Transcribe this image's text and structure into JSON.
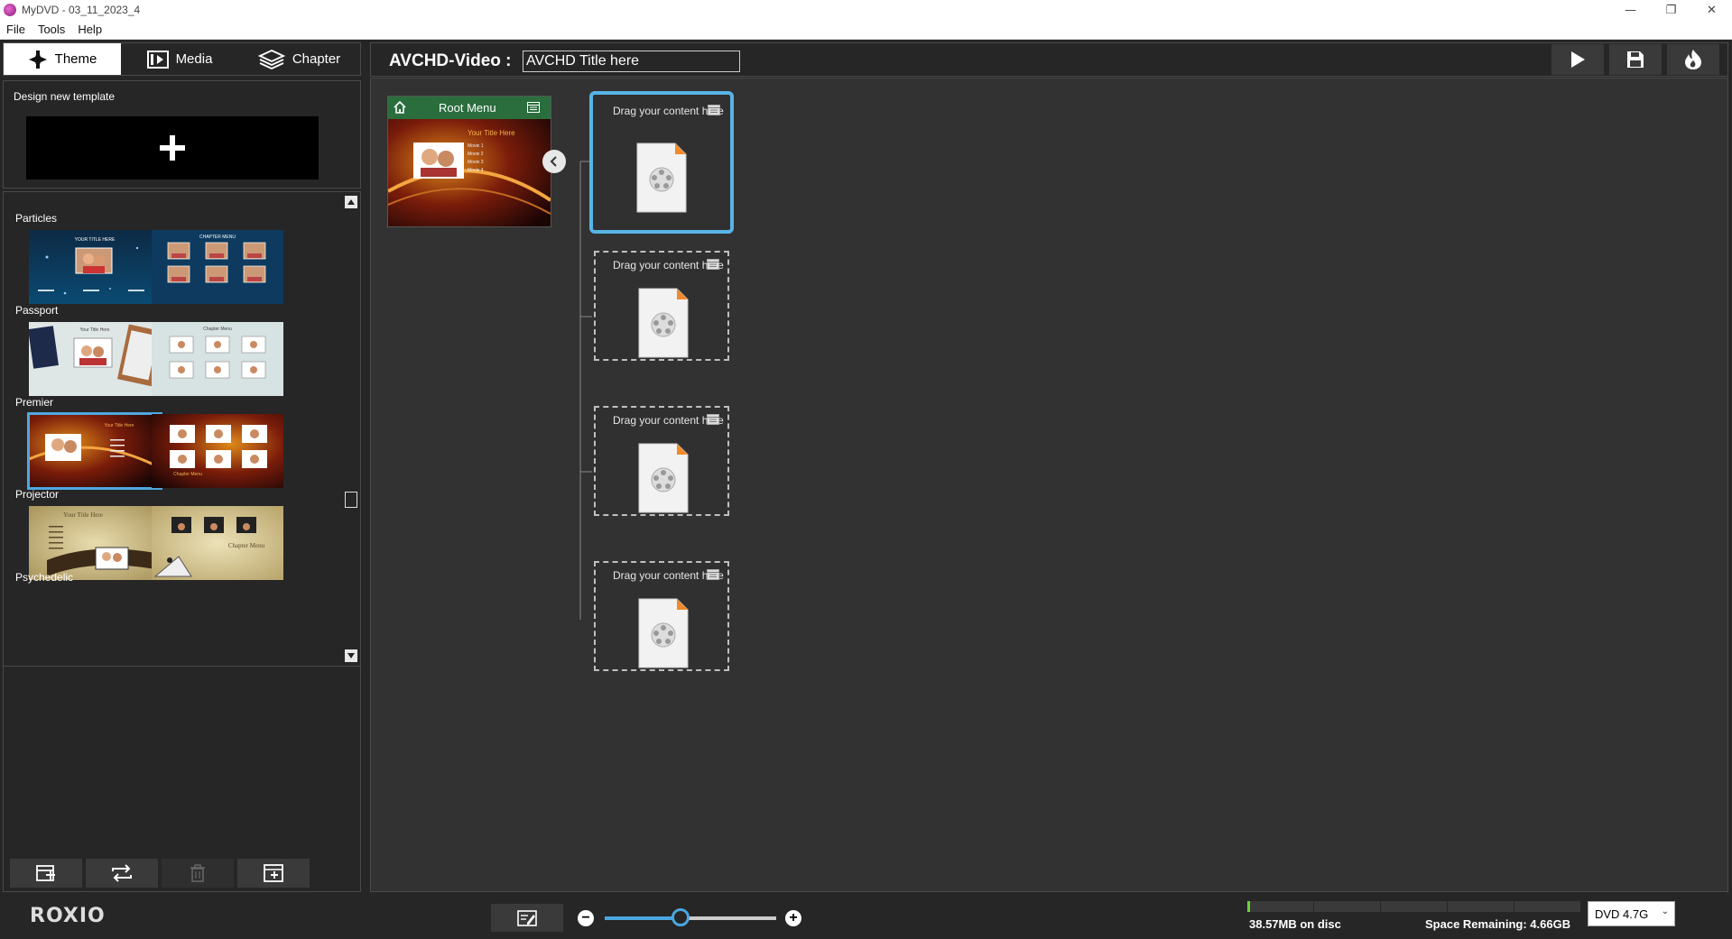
{
  "window": {
    "title": "MyDVD - 03_11_2023_4",
    "controls": {
      "minimize": "—",
      "restore": "❐",
      "close": "✕"
    }
  },
  "menu": {
    "items": [
      "File",
      "Tools",
      "Help"
    ]
  },
  "tabs": [
    {
      "label": "Theme",
      "icon": "theme-icon",
      "active": true
    },
    {
      "label": "Media",
      "icon": "media-icon",
      "active": false
    },
    {
      "label": "Chapter",
      "icon": "chapter-icon",
      "active": false
    }
  ],
  "design": {
    "label": "Design new template",
    "button_icon": "plus-icon"
  },
  "template_categories": [
    {
      "name": "Particles",
      "thumbs": [
        {
          "title": "YOUR TITLE HERE",
          "kind": "main"
        },
        {
          "title": "CHAPTER MENU",
          "kind": "chapter"
        }
      ]
    },
    {
      "name": "Passport",
      "thumbs": [
        {
          "title": "Your Title Here",
          "kind": "main"
        },
        {
          "title": "Chapter Menu",
          "kind": "chapter"
        }
      ]
    },
    {
      "name": "Premier",
      "thumbs": [
        {
          "title": "Your Title Here",
          "kind": "main",
          "selected": true
        },
        {
          "title": "Chapter Menu",
          "kind": "chapter"
        }
      ]
    },
    {
      "name": "Projector",
      "thumbs": [
        {
          "title": "Your Title Here",
          "kind": "main"
        },
        {
          "title": "Chapter Menu",
          "kind": "chapter"
        }
      ]
    },
    {
      "name": "Psychedelic",
      "thumbs": []
    }
  ],
  "left_actions": [
    {
      "name": "add-menu-button",
      "icon": "add-menu-icon",
      "enabled": true
    },
    {
      "name": "swap-button",
      "icon": "swap-icon",
      "enabled": true
    },
    {
      "name": "delete-button",
      "icon": "trash-icon",
      "enabled": false
    },
    {
      "name": "add-submenu-button",
      "icon": "add-submenu-icon",
      "enabled": true
    }
  ],
  "project": {
    "format_label": "AVCHD-Video :",
    "title_value": "AVCHD Title here"
  },
  "header_buttons": [
    {
      "name": "play-button",
      "icon": "play-icon"
    },
    {
      "name": "save-button",
      "icon": "save-icon"
    },
    {
      "name": "burn-button",
      "icon": "flame-icon"
    }
  ],
  "root_menu": {
    "title": "Root Menu",
    "preview_title": "Your Title Here",
    "preview_items": [
      "Movie 1",
      "Movie 2",
      "Movie 3",
      "Movie 4"
    ]
  },
  "slots": [
    {
      "label": "Drag your content here",
      "active": true
    },
    {
      "label": "Drag your content here",
      "active": false
    },
    {
      "label": "Drag your content here",
      "active": false
    },
    {
      "label": "Drag your content here",
      "active": false
    }
  ],
  "bottom": {
    "brand": "ROXIO",
    "zoom_fraction": 0.44,
    "disc_used_text": "38.57MB on disc",
    "space_remaining_text": "Space Remaining: 4.66GB",
    "disc_used_fraction": 0.008,
    "disc_type": "DVD 4.7G"
  },
  "colors": {
    "accent": "#4fa8e0",
    "root_bar": "#2a6e3d",
    "disc_used": "#6fcf3a",
    "background": "#262626"
  }
}
